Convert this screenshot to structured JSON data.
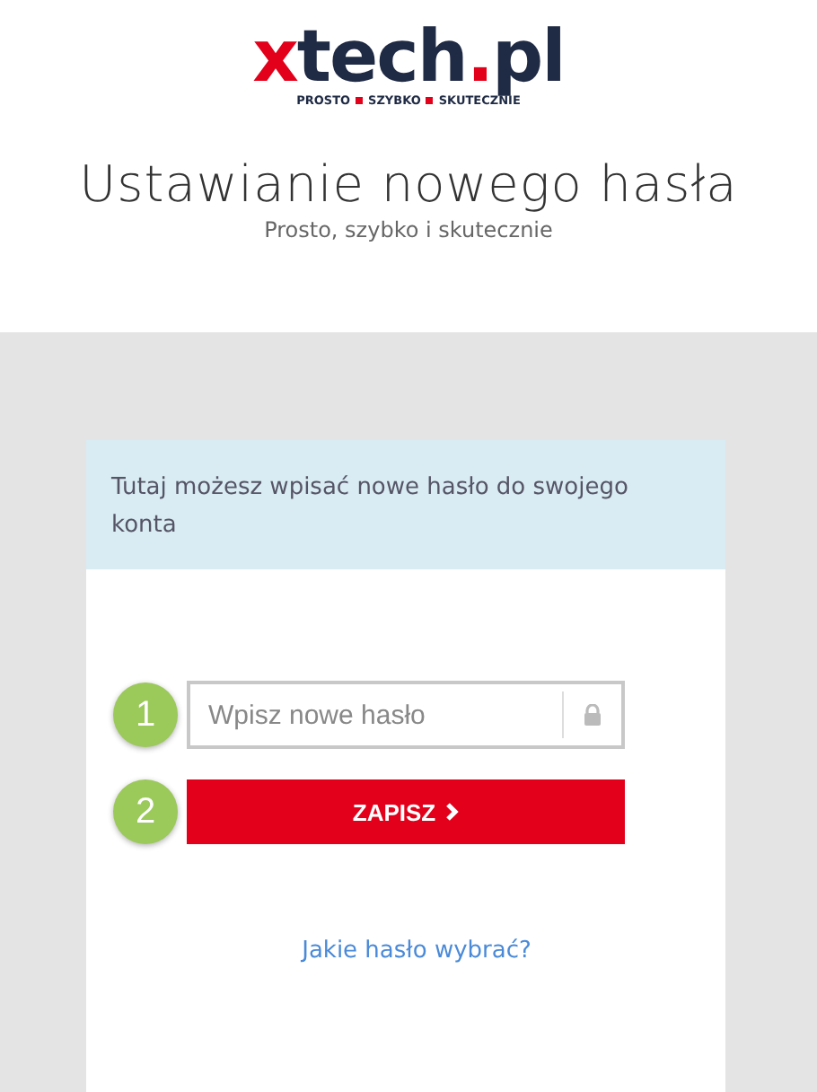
{
  "logo": {
    "parts": [
      {
        "text": "x",
        "color": "#e2001a"
      },
      {
        "text": "tech",
        "color": "#1f2a44"
      },
      {
        "text": ".",
        "color": "#e2001a"
      },
      {
        "text": "pl",
        "color": "#1f2a44"
      }
    ],
    "tagline": [
      "PROSTO",
      "SZYBKO",
      "SKUTECZNIE"
    ]
  },
  "heading": {
    "title": "Ustawianie nowego hasła",
    "subtitle": "Prosto, szybko i skutecznie"
  },
  "card": {
    "info": "Tutaj możesz wpisać nowe hasło do swojego konta",
    "steps": [
      {
        "number": "1",
        "kind": "field",
        "placeholder": "Wpisz nowe hasło"
      },
      {
        "number": "2",
        "kind": "button",
        "label": "ZAPISZ"
      }
    ],
    "link": "Jakie hasło wybrać?"
  }
}
